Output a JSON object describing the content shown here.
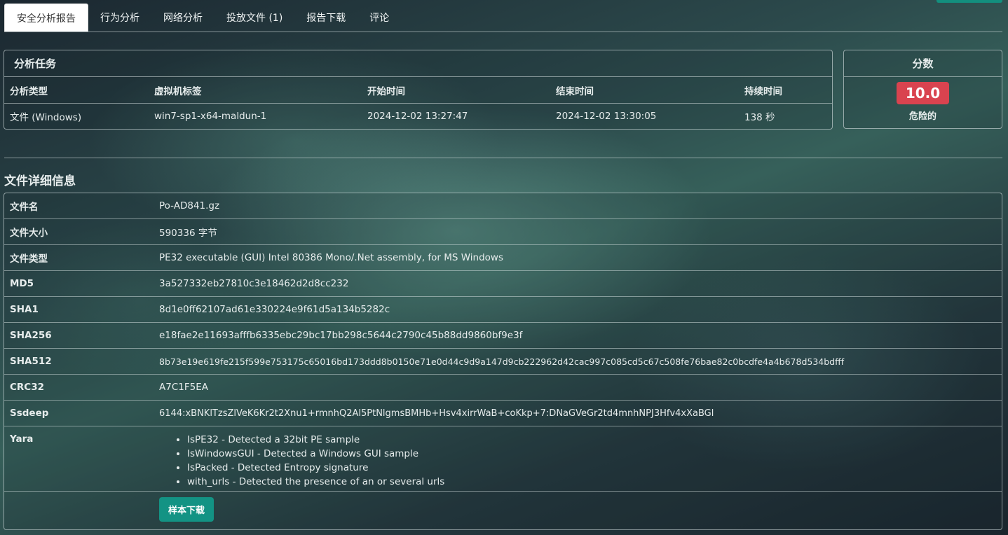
{
  "tabs": [
    {
      "label": "安全分析报告",
      "active": true
    },
    {
      "label": "行为分析"
    },
    {
      "label": "网络分析"
    },
    {
      "label": "投放文件 (1)"
    },
    {
      "label": "报告下载"
    },
    {
      "label": "评论"
    }
  ],
  "task": {
    "title": "分析任务",
    "headers": [
      "分析类型",
      "虚拟机标签",
      "开始时间",
      "结束时间",
      "持续时间"
    ],
    "row": [
      "文件 (Windows)",
      "win7-sp1-x64-maldun-1",
      "2024-12-02 13:27:47",
      "2024-12-02 13:30:05",
      "138 秒"
    ]
  },
  "score": {
    "title": "分数",
    "value": "10.0",
    "label": "危险的",
    "badge_color": "#d9434f"
  },
  "details": {
    "title": "文件详细信息",
    "rows": [
      {
        "key": "文件名",
        "value": "Po-AD841.gz"
      },
      {
        "key": "文件大小",
        "value": "590336 字节"
      },
      {
        "key": "文件类型",
        "value": "PE32 executable (GUI) Intel 80386 Mono/.Net assembly, for MS Windows"
      },
      {
        "key": "MD5",
        "value": "3a527332eb27810c3e18462d2d8cc232"
      },
      {
        "key": "SHA1",
        "value": "8d1e0ff62107ad61e330224e9f61d5a134b5282c"
      },
      {
        "key": "SHA256",
        "value": "e18fae2e11693afffb6335ebc29bc17bb298c5644c2790c45b88dd9860bf9e3f"
      },
      {
        "key": "SHA512",
        "value": "8b73e19e619fe215f599e753175c65016bd173ddd8b0150e71e0d44c9d9a147d9cb222962d42cac997c085cd5c67c508fe76bae82c0bcdfe4a4b678d534bdfff"
      },
      {
        "key": "CRC32",
        "value": "A7C1F5EA"
      },
      {
        "key": "Ssdeep",
        "value": "6144:xBNKlTzsZlVeK6Kr2t2Xnu1+rmnhQ2Al5PtNlgmsBMHb+Hsv4xirrWaB+coKkp+7:DNaGVeGr2td4mnhNPJ3Hfv4xXaBGl"
      }
    ],
    "yara_key": "Yara",
    "yara": [
      "IsPE32 - Detected a 32bit PE sample",
      "IsWindowsGUI - Detected a Windows GUI sample",
      "IsPacked - Detected Entropy signature",
      "with_urls - Detected the presence of an or several urls"
    ],
    "download_label": "样本下载"
  },
  "colors": {
    "accent": "#139384",
    "danger": "#d9434f"
  }
}
